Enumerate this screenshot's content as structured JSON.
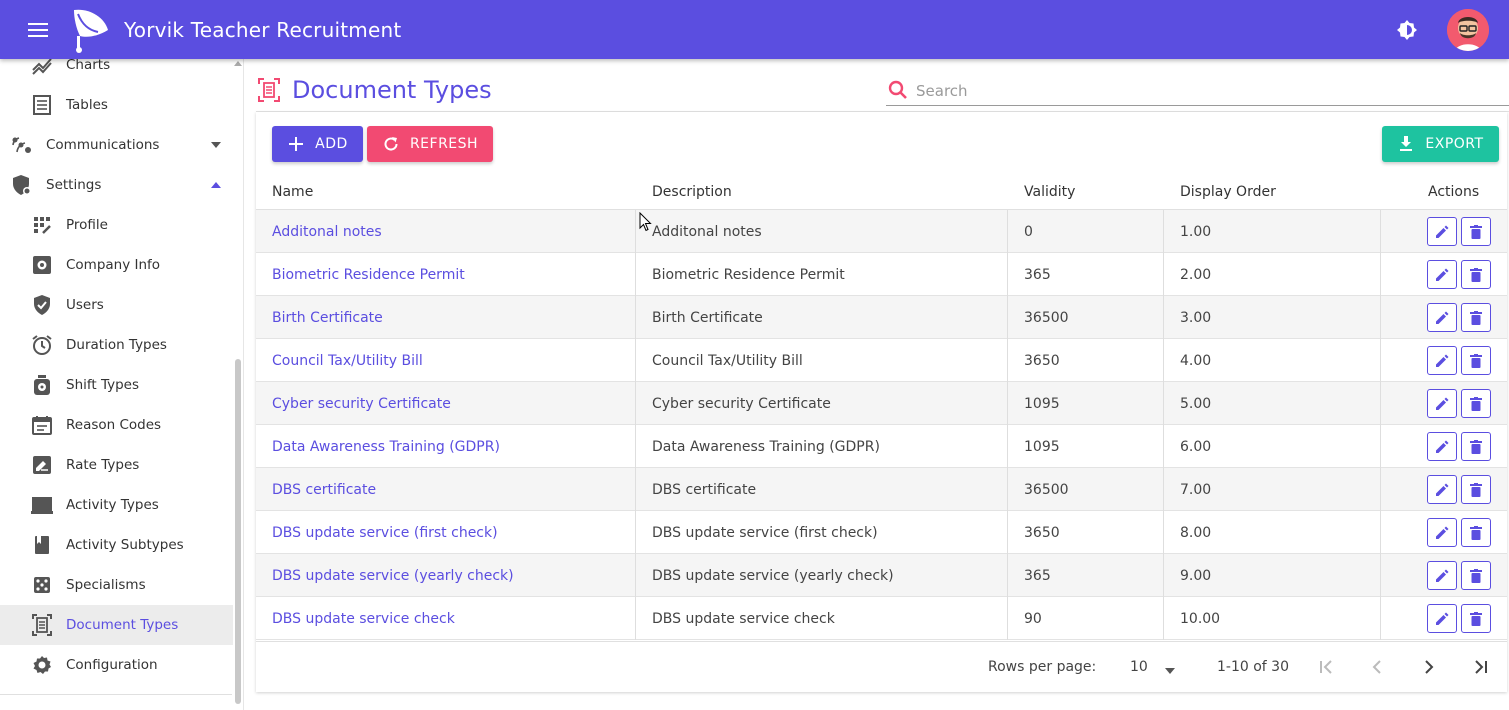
{
  "app": {
    "title": "Yorvik Teacher Recruitment"
  },
  "colors": {
    "primary": "#5b4ee0",
    "accent_pink": "#f24a72",
    "accent_teal": "#1ec3a0"
  },
  "sidebar": {
    "items": [
      {
        "label": "Charts",
        "icon": "chart-line-icon"
      },
      {
        "label": "Tables",
        "icon": "table-icon"
      },
      {
        "label": "Communications",
        "icon": "communications-icon"
      },
      {
        "label": "Settings",
        "icon": "shield-gear-icon"
      },
      {
        "label": "Profile",
        "icon": "profile-dots-icon"
      },
      {
        "label": "Company Info",
        "icon": "cog-box-icon"
      },
      {
        "label": "Users",
        "icon": "shield-check-icon"
      },
      {
        "label": "Duration Types",
        "icon": "alarm-clock-icon"
      },
      {
        "label": "Shift Types",
        "icon": "stopwatch-icon"
      },
      {
        "label": "Reason Codes",
        "icon": "calendar-icon"
      },
      {
        "label": "Rate Types",
        "icon": "signature-icon"
      },
      {
        "label": "Activity Types",
        "icon": "laptop-icon"
      },
      {
        "label": "Activity Subtypes",
        "icon": "book-icon"
      },
      {
        "label": "Specialisms",
        "icon": "dice-icon"
      },
      {
        "label": "Document Types",
        "icon": "document-frame-icon"
      },
      {
        "label": "Configuration",
        "icon": "gear-icon"
      }
    ]
  },
  "page": {
    "title": "Document Types",
    "search_placeholder": "Search"
  },
  "toolbar": {
    "add_label": "ADD",
    "refresh_label": "REFRESH",
    "export_label": "EXPORT"
  },
  "table": {
    "columns": [
      "Name",
      "Description",
      "Validity",
      "Display Order",
      "Actions"
    ],
    "rows": [
      {
        "name": "Additonal notes",
        "description": "Additonal notes",
        "validity": "0",
        "order": "1.00"
      },
      {
        "name": "Biometric Residence Permit",
        "description": "Biometric Residence Permit",
        "validity": "365",
        "order": "2.00"
      },
      {
        "name": "Birth Certificate",
        "description": "Birth Certificate",
        "validity": "36500",
        "order": "3.00"
      },
      {
        "name": "Council Tax/Utility Bill",
        "description": "Council Tax/Utility Bill",
        "validity": "3650",
        "order": "4.00"
      },
      {
        "name": "Cyber security Certificate",
        "description": "Cyber security Certificate",
        "validity": "1095",
        "order": "5.00"
      },
      {
        "name": "Data Awareness Training (GDPR)",
        "description": "Data Awareness Training (GDPR)",
        "validity": "1095",
        "order": "6.00"
      },
      {
        "name": "DBS certificate",
        "description": "DBS certificate",
        "validity": "36500",
        "order": "7.00"
      },
      {
        "name": "DBS update service (first check)",
        "description": "DBS update service (first check)",
        "validity": "3650",
        "order": "8.00"
      },
      {
        "name": "DBS update service (yearly check)",
        "description": "DBS update service (yearly check)",
        "validity": "365",
        "order": "9.00"
      },
      {
        "name": "DBS update service check",
        "description": "DBS update service check",
        "validity": "90",
        "order": "10.00"
      }
    ]
  },
  "pagination": {
    "rows_per_page_label": "Rows per page:",
    "rows_per_page": "10",
    "range": "1-10 of 30"
  }
}
